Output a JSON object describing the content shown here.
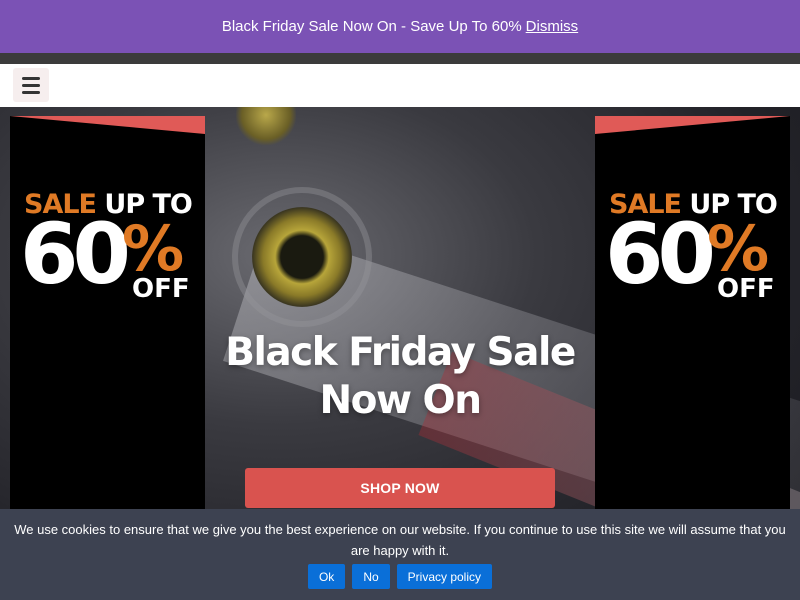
{
  "promo": {
    "message": "Black Friday Sale Now On - Save Up To 60%",
    "dismiss_label": "Dismiss",
    "background_color": "#7b52b5"
  },
  "header": {
    "menu_icon": "hamburger-menu-icon"
  },
  "hero": {
    "title_line1": "Black Friday Sale",
    "title_line2": "Now On",
    "cta_label": "SHOP NOW",
    "cta_color": "#d9534f",
    "banners": [
      {
        "sale_word": "SALE",
        "upto": "UP TO",
        "number": "60",
        "percent": "%",
        "off": "OFF"
      },
      {
        "sale_word": "SALE",
        "upto": "UP TO",
        "number": "60",
        "percent": "%",
        "off": "OFF"
      }
    ],
    "accent_color": "#e07a25",
    "ribbon_color": "#e05a57"
  },
  "cookie": {
    "message": "We use cookies to ensure that we give you the best experience on our website. If you continue to use this site we will assume that you are happy with it.",
    "buttons": [
      "Ok",
      "No",
      "Privacy policy"
    ],
    "button_color": "#0a6fd8",
    "background_color": "#3d4251"
  }
}
